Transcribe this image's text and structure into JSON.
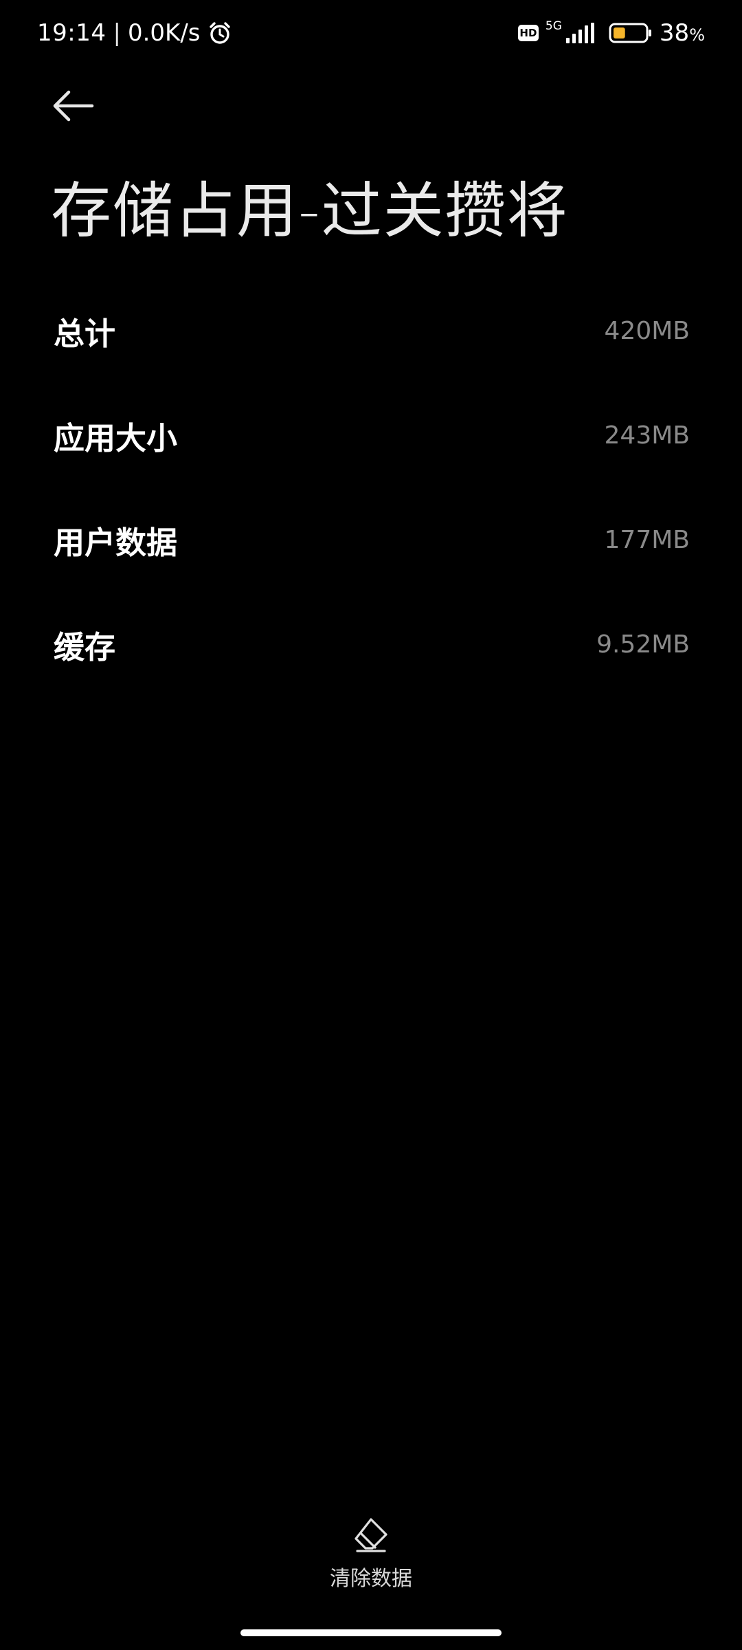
{
  "status_bar": {
    "time": "19:14",
    "separator": "|",
    "net_speed": "0.0K/s",
    "alarm_icon": "alarm-clock-icon",
    "hd_label": "HD",
    "network_type": "5G",
    "signal_icon": "signal-bars-icon",
    "battery_icon": "battery-icon",
    "battery_level": 38,
    "battery_percent": "38",
    "percent_sign": "%",
    "battery_color": "#F5B52A"
  },
  "header": {
    "back_icon": "arrow-left-icon",
    "title": "存储占用-过关攒将"
  },
  "storage": {
    "rows": [
      {
        "label": "总计",
        "value": "420MB"
      },
      {
        "label": "应用大小",
        "value": "243MB"
      },
      {
        "label": "用户数据",
        "value": "177MB"
      },
      {
        "label": "缓存",
        "value": "9.52MB"
      }
    ]
  },
  "actions": {
    "clear_data_icon": "eraser-icon",
    "clear_data_label": "清除数据"
  },
  "colors": {
    "background": "#000000",
    "text_primary": "#FFFFFF",
    "text_secondary": "#8A8A8A"
  }
}
